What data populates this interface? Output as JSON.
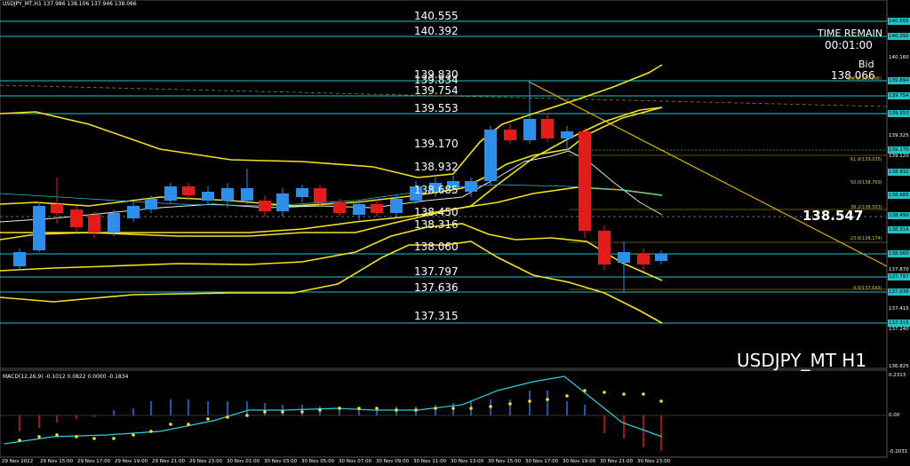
{
  "header": {
    "text": "USDJPY_MT,H1  137.986 138.106 137.946 138.066"
  },
  "levels": [
    "140.555",
    "140.392",
    "139.830",
    "139.834",
    "139.754",
    "139.553",
    "139.170",
    "138.932",
    "138.685",
    "138.450",
    "138.316",
    "138.060",
    "137.797",
    "137.636",
    "137.315"
  ],
  "price_axis": [
    "140.555",
    "140.392",
    "140.160",
    "139.894",
    "139.754",
    "139.553",
    "139.325",
    "139.170",
    "139.120",
    "138.932",
    "138.685",
    "138.490",
    "138.316",
    "138.060",
    "137.870",
    "137.797",
    "137.636",
    "137.415",
    "137.315",
    "137.240",
    "136.825",
    "0.2313",
    "0.00",
    "-0.2031"
  ],
  "time_axis": [
    "29 Nov 2022",
    "29 Nov 15:00",
    "29 Nov 17:00",
    "29 Nov 19:00",
    "29 Nov 21:00",
    "29 Nov 23:00",
    "30 Nov 01:00",
    "30 Nov 03:00",
    "30 Nov 05:00",
    "30 Nov 07:00",
    "30 Nov 09:00",
    "30 Nov 11:00",
    "30 Nov 13:00",
    "30 Nov 15:00",
    "30 Nov 17:00",
    "30 Nov 19:00",
    "30 Nov 21:00",
    "30 Nov 23:00"
  ],
  "info_box": {
    "time_remain_label": "TIME REMAIN",
    "time_remain": "00:01:00",
    "bid_label": "Bid",
    "bid": "138.066"
  },
  "big_price": "138.547",
  "symbol": "USDJPY_MT H1",
  "fib_labels": [
    "100.0(139.896)",
    "61.8(139.035)",
    "50.0(138.769)",
    "38.2(138.503)",
    "23.6(138.174)",
    "0.0(137.643)"
  ],
  "macd_label": "MACD(12,26,9) -0.1012 0.0822 0.0000 -0.1834",
  "colors": {
    "bull": "#2e8fe8",
    "bear": "#e21b1b",
    "level": "#21c3c7",
    "band": "#f5e21e"
  }
}
